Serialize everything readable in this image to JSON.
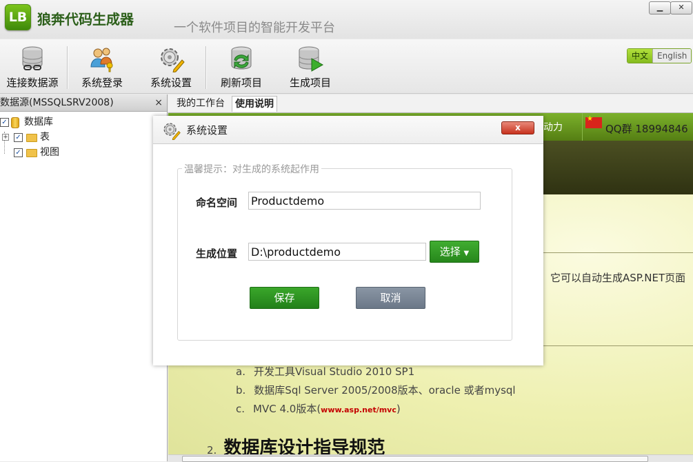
{
  "app": {
    "logo": "LB",
    "title": "狼奔代码生成器",
    "slogan": "一个软件项目的智能开发平台",
    "window_controls": [
      "minimize",
      "close"
    ]
  },
  "toolbar": {
    "items": [
      {
        "label": "连接数据源",
        "icon": "database-link-icon"
      },
      {
        "label": "系统登录",
        "icon": "users-key-icon"
      },
      {
        "label": "系统设置",
        "icon": "gear-pencil-icon"
      },
      {
        "label": "刷新项目",
        "icon": "database-refresh-icon"
      },
      {
        "label": "生成项目",
        "icon": "database-play-icon"
      }
    ]
  },
  "language": {
    "active": "中文",
    "other": "English"
  },
  "left_panel": {
    "header": "数据源(MSSQLSRV2008)",
    "close": "×",
    "tree": [
      {
        "label": "数据库",
        "checked": true,
        "level": 0
      },
      {
        "label": "表",
        "checked": true,
        "level": 1
      },
      {
        "label": "视图",
        "checked": true,
        "level": 1
      }
    ]
  },
  "tabs": [
    {
      "label": "我的工作台",
      "active": false
    },
    {
      "label": "使用说明",
      "active": true
    }
  ],
  "content": {
    "nav_partial": "动力",
    "qq_label": "QQ群 18994846",
    "intro_fragment": "它可以自动生成ASP.NET页面",
    "requirements": [
      {
        "marker": "a.",
        "text": "开发工具Visual Studio 2010 SP1"
      },
      {
        "marker": "b.",
        "text": "数据库Sql Server 2005/2008版本、oracle 或者mysql"
      },
      {
        "marker": "c.",
        "text": "MVC 4.0版本(",
        "link": "www.asp.net/mvc",
        "suffix": ")"
      }
    ],
    "section2": {
      "number": "2.",
      "title": "数据库设计指导规范"
    }
  },
  "dialog": {
    "title": "系统设置",
    "close_label": "x",
    "hint": "温馨提示：对生成的系统起作用",
    "namespace": {
      "label": "命名空间",
      "value": "Productdemo"
    },
    "output": {
      "label": "生成位置",
      "value": "D:\\productdemo"
    },
    "select_button": "选择",
    "save_button": "保存",
    "cancel_button": "取消"
  }
}
